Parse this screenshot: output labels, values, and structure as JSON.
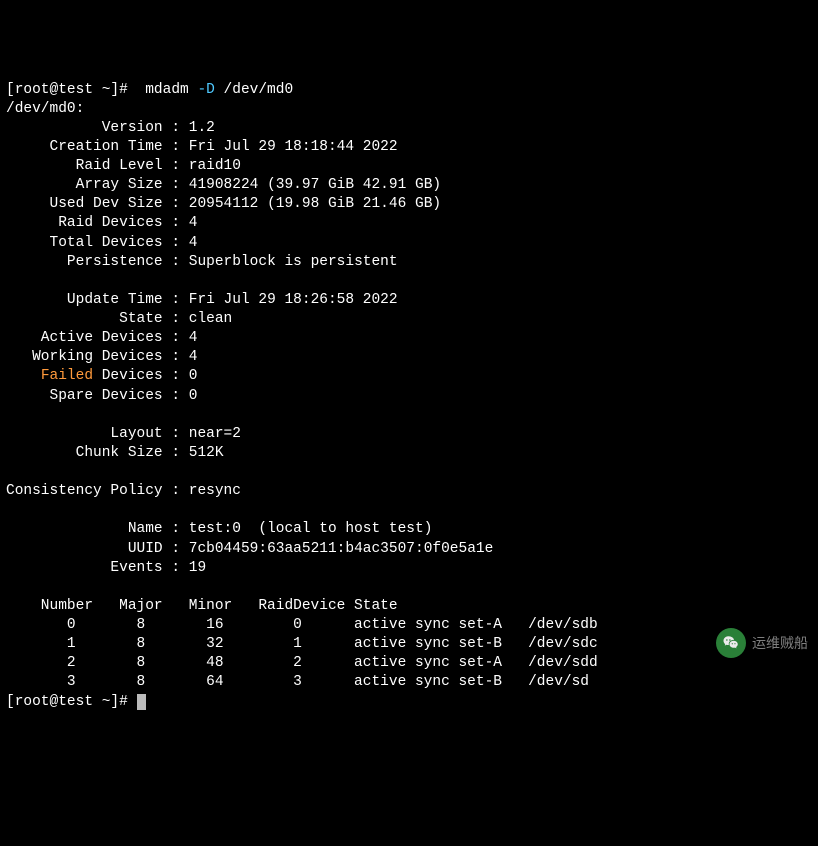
{
  "prompt1": "[root@test ~]#  mdadm ",
  "cmd_flag": "-D",
  "cmd_arg": " /dev/md0",
  "device_line": "/dev/md0:",
  "fields": {
    "version": {
      "label": "           Version",
      "value": "1.2"
    },
    "creation_time": {
      "label": "     Creation Time",
      "value": "Fri Jul 29 18:18:44 2022"
    },
    "raid_level": {
      "label": "        Raid Level",
      "value": "raid10"
    },
    "array_size": {
      "label": "        Array Size",
      "value": "41908224 (39.97 GiB 42.91 GB)"
    },
    "used_dev_size": {
      "label": "     Used Dev Size",
      "value": "20954112 (19.98 GiB 21.46 GB)"
    },
    "raid_devices": {
      "label": "      Raid Devices",
      "value": "4"
    },
    "total_devices": {
      "label": "     Total Devices",
      "value": "4"
    },
    "persistence": {
      "label": "       Persistence",
      "value": "Superblock is persistent"
    },
    "update_time": {
      "label": "       Update Time",
      "value": "Fri Jul 29 18:26:58 2022"
    },
    "state": {
      "label": "             State",
      "value": "clean"
    },
    "active_devices": {
      "label": "    Active Devices",
      "value": "4"
    },
    "working_devices": {
      "label": "   Working Devices",
      "value": "4"
    },
    "failed_prefix": "    ",
    "failed_word": "Failed",
    "failed_suffix": " Devices",
    "failed_value": "0",
    "spare_devices": {
      "label": "     Spare Devices",
      "value": "0"
    },
    "layout": {
      "label": "            Layout",
      "value": "near=2"
    },
    "chunk_size": {
      "label": "        Chunk Size",
      "value": "512K"
    },
    "consistency": {
      "label": "Consistency Policy",
      "value": "resync"
    },
    "name": {
      "label": "              Name",
      "value": "test:0  (local to host test)"
    },
    "uuid": {
      "label": "              UUID",
      "value": "7cb04459:63aa5211:b4ac3507:0f0e5a1e"
    },
    "events": {
      "label": "            Events",
      "value": "19"
    }
  },
  "table": {
    "header": "    Number   Major   Minor   RaidDevice State",
    "rows": [
      "       0       8       16        0      active sync set-A   /dev/sdb",
      "       1       8       32        1      active sync set-B   /dev/sdc",
      "       2       8       48        2      active sync set-A   /dev/sdd",
      "       3       8       64        3      active sync set-B   /dev/sd"
    ]
  },
  "prompt2": "[root@test ~]# ",
  "watermark_text": "运维贼船"
}
